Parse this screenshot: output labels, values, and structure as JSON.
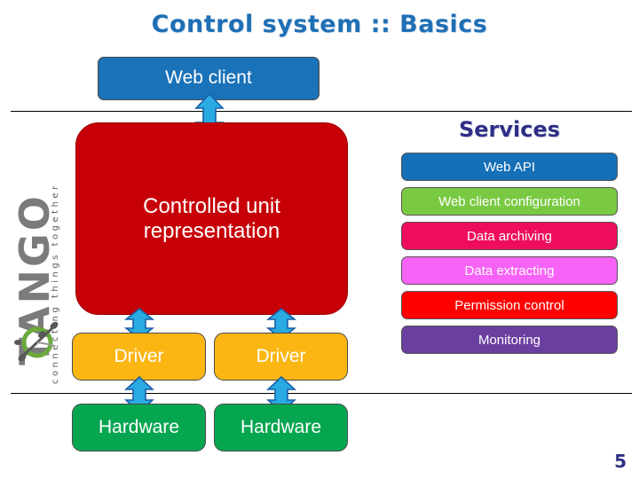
{
  "slide": {
    "title": "Control system :: Basics",
    "title_color": "#1f6fb5",
    "page_number": "5",
    "page_number_color": "#2e2e86"
  },
  "logo": {
    "wordmark": "TANGO",
    "tagline": "connecting things together",
    "mark_color": "#6aaa3c",
    "text_color": "#7b7b7b"
  },
  "client_layer": {
    "web_client": {
      "label": "Web client",
      "color": "#1a72b8"
    }
  },
  "core": {
    "label_line1": "Controlled unit",
    "label_line2": "representation",
    "color": "#c70007"
  },
  "drivers": [
    {
      "label": "Driver",
      "color": "#fbb614"
    },
    {
      "label": "Driver",
      "color": "#fbb614"
    }
  ],
  "hardware": [
    {
      "label": "Hardware",
      "color": "#06a651"
    },
    {
      "label": "Hardware",
      "color": "#06a651"
    }
  ],
  "services": {
    "heading": "Services",
    "heading_color": "#2e2e86",
    "items": [
      {
        "label": "Web API",
        "color": "#1570b8"
      },
      {
        "label": "Web client configuration",
        "color": "#7ac943"
      },
      {
        "label": "Data archiving",
        "color": "#ee0d5c"
      },
      {
        "label": "Data extracting",
        "color": "#f763f7"
      },
      {
        "label": "Permission control",
        "color": "#fe0000"
      },
      {
        "label": "Monitoring",
        "color": "#6b3fa0"
      }
    ]
  },
  "arrows": {
    "fill": "#29abe2",
    "stroke": "#1b5fa8",
    "count": 5
  }
}
